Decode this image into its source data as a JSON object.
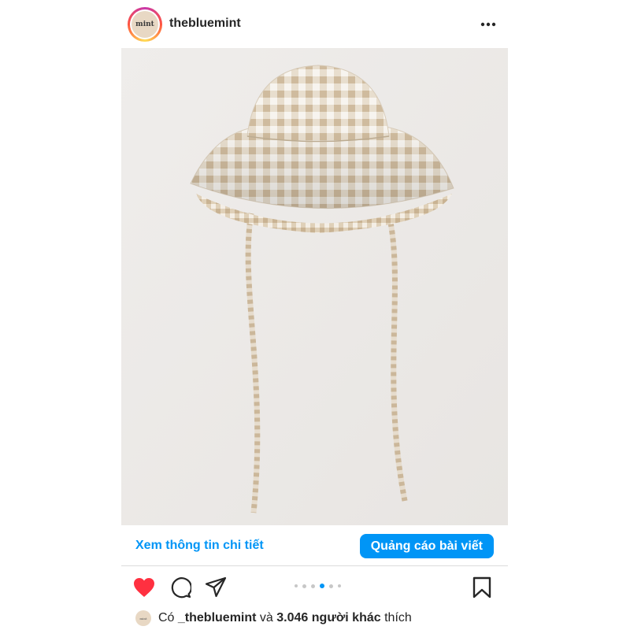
{
  "header": {
    "avatar_text": "mint",
    "username": "thebluemint",
    "more_icon": "more-horizontal-icon"
  },
  "post": {
    "image_subject": "beige gingham bucket hat with ties"
  },
  "cta": {
    "details_link": "Xem thông tin chi tiết",
    "promote_button": "Quảng cáo bài viết"
  },
  "actions": {
    "icons": [
      "heart-icon",
      "comment-icon",
      "share-icon",
      "bookmark-icon"
    ],
    "liked": true,
    "carousel_dot_count": 6,
    "carousel_active_index": 3
  },
  "likes": {
    "prefix": "Có",
    "user": "_thebluemint",
    "middle": "và",
    "others": "3.046 người khác",
    "suffix": "thích"
  },
  "colors": {
    "accent": "#0095f6",
    "like_red": "#ff3040",
    "gingham": "#d9c9b0"
  }
}
